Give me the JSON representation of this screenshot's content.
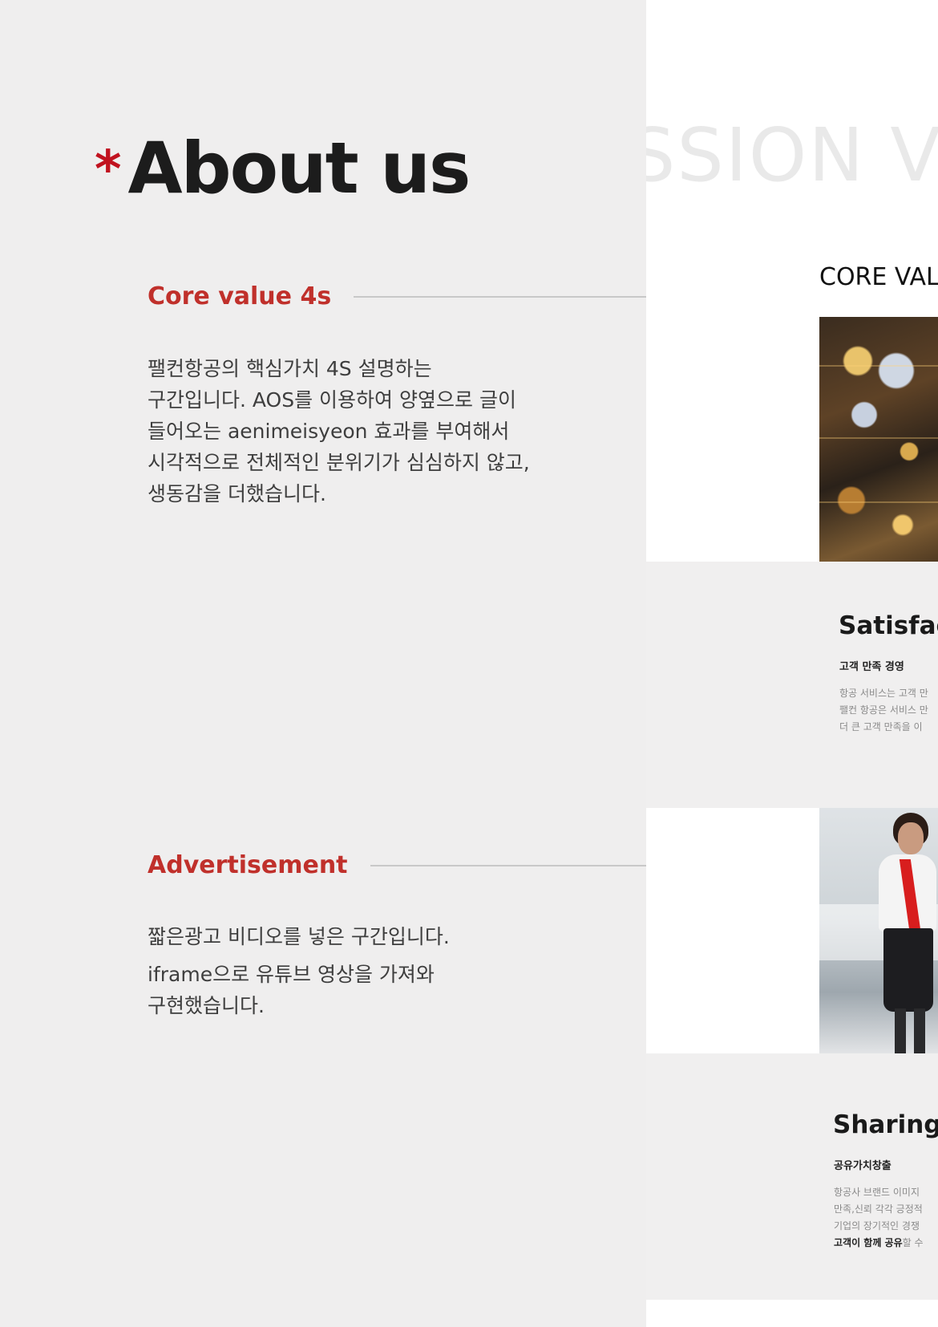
{
  "heading": {
    "asterisk": "*",
    "title": "About us"
  },
  "sections": [
    {
      "title": "Core value 4s",
      "desc": "팰컨항공의 핵심가치 4S 설명하는 구간입니다. AOS를 이용하여 양옆으로 글이 들어오는 aenimeisyeon 효과를 부여해서 시각적으로 전체적인 분위기가 심심하지 않고, 생동감을 더했습니다."
    },
    {
      "title": "Advertisement",
      "desc_line1": "짧은광고 비디오를 넣은 구간입니다.",
      "desc_line2": "iframe으로 유튜브 영상을 가져와 구현했습니다."
    }
  ],
  "preview": {
    "background_word": "SSION VIS",
    "core_heading": "CORE VALU",
    "cards": [
      {
        "title": "Satisfact",
        "subtitle": "고객 만족 경영",
        "lines": [
          "항공 서비스는 고객 만",
          "팰컨 항공은 서비스 만",
          "더 큰 고객 만족을 이"
        ]
      },
      {
        "title": "Sharing",
        "subtitle": "공유가치창출",
        "lines": [
          "항공사 브랜드 이미지",
          "만족,신뢰 각각 긍정적",
          "기업의 장기적인 경쟁"
        ],
        "last_line_bold": "고객이 함께 공유",
        "last_line_rest": "할 수"
      }
    ]
  },
  "colors": {
    "accent_red": "#c0302b",
    "dot_red": "#d83a2e",
    "page_bg": "#efeeee",
    "panel_white": "#ffffff"
  },
  "icons": {
    "heading_mark": "asterisk-icon",
    "connector_end": "dot-icon"
  }
}
